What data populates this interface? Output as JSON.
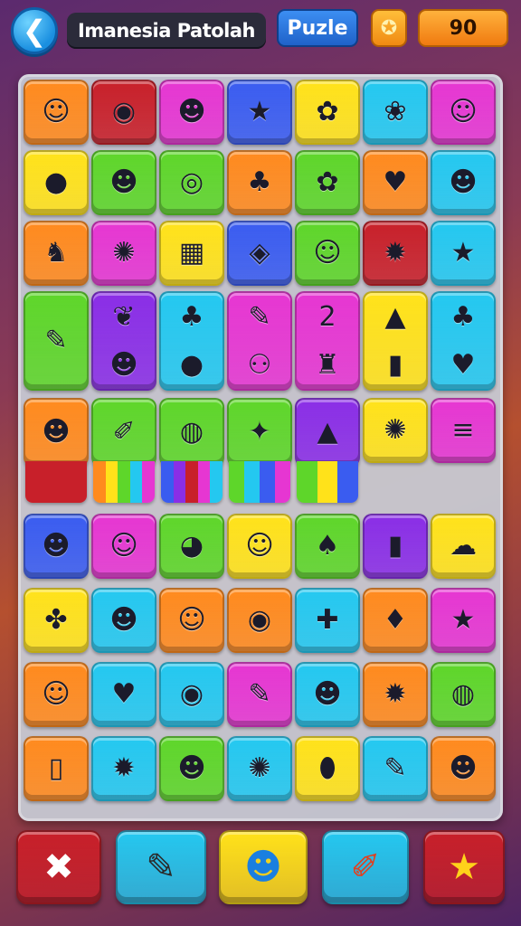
{
  "header": {
    "back_icon": "arrow-left-icon",
    "back_glyph": "❮",
    "title": "Imanesia Patolah",
    "mode_label": "Puzle",
    "coin_icon": "gear-badge-icon",
    "coin_glyph": "✪",
    "score": "90"
  },
  "colors": {
    "orange": "#ff8a1e",
    "red": "#c8202a",
    "magenta": "#e636d2",
    "blue": "#3a5cf0",
    "yellow": "#ffe21a",
    "cyan": "#24c8f0",
    "green": "#5ed62a",
    "purple": "#8a2ee6",
    "pink": "#ff4fb0"
  },
  "board": {
    "rows": [
      [
        {
          "c": "orange",
          "g": "☺",
          "icon": "cowboy-face-icon"
        },
        {
          "c": "red",
          "g": "◉",
          "icon": "lollipop-icon"
        },
        {
          "c": "magenta",
          "g": "☻",
          "icon": "green-monster-icon"
        },
        {
          "c": "blue",
          "g": "★",
          "icon": "yellow-star-icon"
        },
        {
          "c": "yellow",
          "g": "✿",
          "icon": "blue-flower-icon"
        },
        {
          "c": "cyan",
          "g": "❀",
          "icon": "orange-bug-icon"
        },
        {
          "c": "magenta",
          "g": "☺",
          "icon": "white-cat-icon"
        }
      ],
      [
        {
          "c": "yellow",
          "g": "●",
          "icon": "blue-pot-icon"
        },
        {
          "c": "green",
          "g": "☻",
          "icon": "yellow-face-icon"
        },
        {
          "c": "green",
          "g": "◎",
          "icon": "magnifier-icon"
        },
        {
          "c": "orange",
          "g": "♣",
          "icon": "green-bird-icon"
        },
        {
          "c": "green",
          "g": "✿",
          "icon": "pink-flower-face-icon"
        },
        {
          "c": "orange",
          "g": "♥",
          "icon": "red-creature-icon"
        },
        {
          "c": "cyan",
          "g": "☻",
          "icon": "yellow-bean-icon"
        }
      ],
      [
        {
          "c": "orange",
          "g": "♞",
          "icon": "pink-pony-icon"
        },
        {
          "c": "magenta",
          "g": "✺",
          "icon": "pink-flower-icon"
        },
        {
          "c": "yellow",
          "g": "▦",
          "icon": "purple-box-icon"
        },
        {
          "c": "blue",
          "g": "◈",
          "icon": "green-gem-icon"
        },
        {
          "c": "green",
          "g": "☺",
          "icon": "cat-girl-icon"
        },
        {
          "c": "red",
          "g": "✹",
          "icon": "red-monster-icon"
        },
        {
          "c": "cyan",
          "g": "★",
          "icon": "star-wand-icon"
        }
      ],
      [
        {
          "c": "green",
          "g": "✎",
          "icon": "striped-crayon-icon",
          "tall": true
        },
        {
          "c": "purple",
          "g": "❦",
          "g2": "☻",
          "icon": "pizza-and-monster-icon",
          "tall": true
        },
        {
          "c": "cyan",
          "g": "♣",
          "g2": "●",
          "icon": "leaf-and-ball-icon",
          "tall": true
        },
        {
          "c": "magenta",
          "g": "✎",
          "g2": "⚇",
          "icon": "marker-and-cart-icon",
          "tall": true
        },
        {
          "c": "magenta",
          "g": "2",
          "g2": "♜",
          "icon": "number-two-and-tower-icon",
          "tall": true
        },
        {
          "c": "yellow",
          "g": "▲",
          "g2": "▮",
          "icon": "bell-and-door-icon",
          "tall": true
        },
        {
          "c": "cyan",
          "g": "♣",
          "g2": "♥",
          "icon": "club-and-heart-icon",
          "tall": true
        }
      ],
      [
        {
          "c": "orange",
          "g": "☻",
          "icon": "wizard-face-icon",
          "stripe": [
            "red",
            "red"
          ]
        },
        {
          "c": "green",
          "g": "✐",
          "icon": "flashlight-icon",
          "stripe": [
            "orange",
            "yellow",
            "green",
            "cyan",
            "magenta"
          ]
        },
        {
          "c": "green",
          "g": "◍",
          "icon": "candy-icon",
          "stripe": [
            "blue",
            "purple",
            "red",
            "magenta",
            "cyan"
          ]
        },
        {
          "c": "green",
          "g": "✦",
          "icon": "orange-creature-icon",
          "stripe": [
            "green",
            "cyan",
            "blue",
            "magenta"
          ]
        },
        {
          "c": "purple",
          "g": "▲",
          "icon": "green-star-icon",
          "stripe": [
            "green",
            "yellow",
            "blue"
          ]
        },
        {
          "c": "yellow",
          "g": "✺",
          "icon": "orange-blob-icon"
        },
        {
          "c": "magenta",
          "g": "≡",
          "icon": "blue-menu-icon"
        }
      ],
      [
        {
          "c": "blue",
          "g": "☻",
          "icon": "green-frog-icon"
        },
        {
          "c": "magenta",
          "g": "☺",
          "icon": "orange-cat-icon"
        },
        {
          "c": "green",
          "g": "◕",
          "icon": "green-eye-icon"
        },
        {
          "c": "yellow",
          "g": "☺",
          "icon": "orange-smile-icon"
        },
        {
          "c": "green",
          "g": "♠",
          "icon": "red-blob-icon"
        },
        {
          "c": "purple",
          "g": "▮",
          "icon": "blue-popsicle-icon"
        },
        {
          "c": "yellow",
          "g": "☁",
          "icon": "green-leaf-face-icon"
        }
      ],
      [
        {
          "c": "yellow",
          "g": "✤",
          "icon": "pinwheel-icon"
        },
        {
          "c": "cyan",
          "g": "☻",
          "icon": "yellow-imp-icon"
        },
        {
          "c": "orange",
          "g": "☺",
          "icon": "green-goblin-icon"
        },
        {
          "c": "orange",
          "g": "◉",
          "icon": "red-round-icon"
        },
        {
          "c": "cyan",
          "g": "✚",
          "icon": "yellow-cross-icon"
        },
        {
          "c": "orange",
          "g": "♦",
          "icon": "green-drop-icon"
        },
        {
          "c": "magenta",
          "g": "★",
          "icon": "orange-star-icon"
        }
      ],
      [
        {
          "c": "orange",
          "g": "☺",
          "icon": "red-hair-face-icon"
        },
        {
          "c": "cyan",
          "g": "♥",
          "icon": "red-heart-blob-icon"
        },
        {
          "c": "cyan",
          "g": "◉",
          "icon": "blue-ring-icon"
        },
        {
          "c": "magenta",
          "g": "✎",
          "icon": "blue-pen-icon"
        },
        {
          "c": "cyan",
          "g": "☻",
          "icon": "green-slime-icon"
        },
        {
          "c": "orange",
          "g": "✹",
          "icon": "sun-face-icon"
        },
        {
          "c": "green",
          "g": "◍",
          "icon": "blue-planet-icon"
        }
      ],
      [
        {
          "c": "orange",
          "g": "▯",
          "icon": "blue-popsicle-small-icon"
        },
        {
          "c": "cyan",
          "g": "✹",
          "icon": "blue-gear-icon"
        },
        {
          "c": "green",
          "g": "☻",
          "icon": "green-bear-icon"
        },
        {
          "c": "cyan",
          "g": "✺",
          "icon": "pink-virus-icon"
        },
        {
          "c": "yellow",
          "g": "⬮",
          "icon": "gray-key-icon"
        },
        {
          "c": "cyan",
          "g": "✎",
          "icon": "rainbow-crayon-icon"
        },
        {
          "c": "orange",
          "g": "☻",
          "icon": "green-pea-icon"
        }
      ]
    ]
  },
  "actions": [
    {
      "name": "cancel-button",
      "icon": "close-x-icon",
      "g": "✖",
      "c": "red",
      "gc": "#ffffff"
    },
    {
      "name": "crayon-button",
      "icon": "crayon-icon",
      "g": "✎",
      "c": "cyan",
      "gc": "#2a2a2a"
    },
    {
      "name": "blob-button",
      "icon": "blue-blob-icon",
      "g": "☻",
      "c": "yellow",
      "gc": "#1a7fe0"
    },
    {
      "name": "carrot-button",
      "icon": "carrot-icon",
      "g": "✐",
      "c": "cyan",
      "gc": "#e04020"
    },
    {
      "name": "star-button",
      "icon": "star-icon",
      "g": "★",
      "c": "red",
      "gc": "#ffd21a"
    }
  ]
}
